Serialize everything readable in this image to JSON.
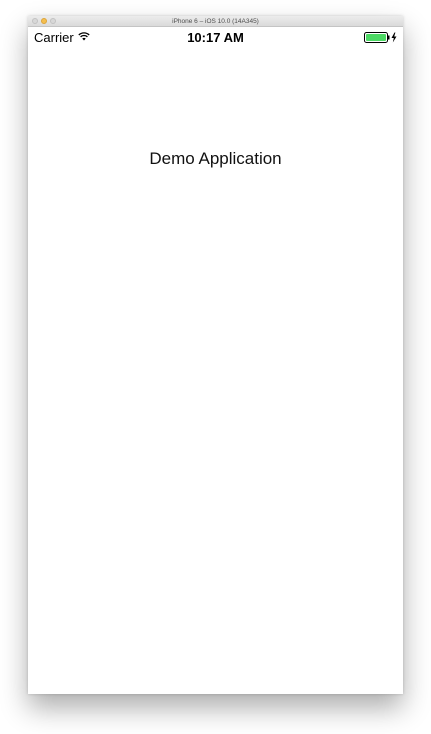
{
  "window": {
    "title": "iPhone 6 – iOS 10.0 (14A345)"
  },
  "status_bar": {
    "carrier": "Carrier",
    "time": "10:17 AM",
    "icons": [
      "wifi-icon",
      "battery-charging-icon"
    ],
    "battery_color": "#4cd964"
  },
  "main": {
    "label": "Demo Application"
  }
}
